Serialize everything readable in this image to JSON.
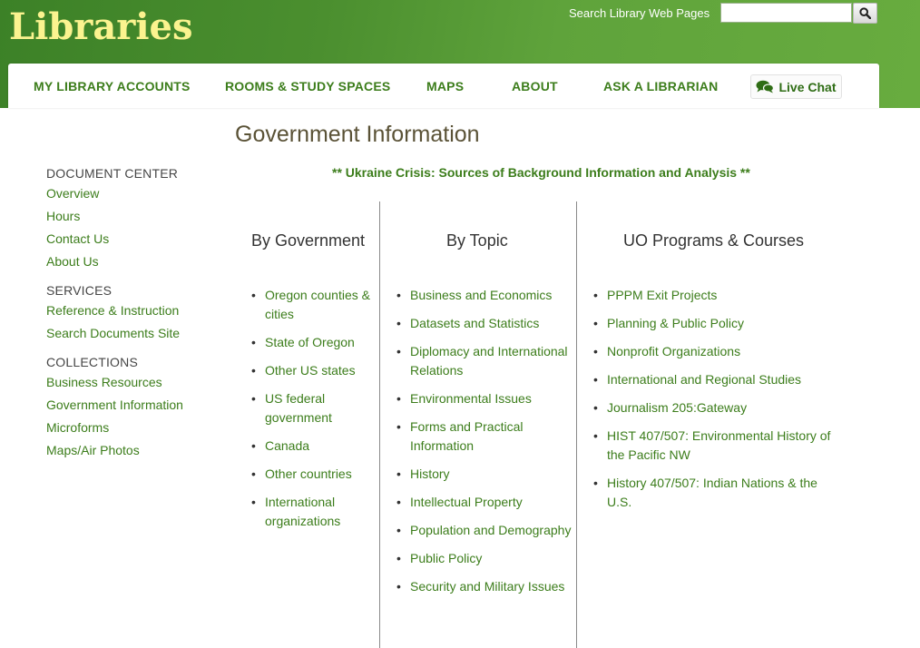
{
  "header": {
    "logo": "Libraries",
    "search_label": "Search Library Web Pages",
    "search_value": "",
    "search_icon": "magnifier-icon"
  },
  "nav": {
    "items": [
      "MY LIBRARY ACCOUNTS",
      "ROOMS & STUDY SPACES",
      "MAPS",
      "ABOUT",
      "ASK A LIBRARIAN"
    ],
    "live_chat": "Live Chat",
    "live_chat_icon": "chat-bubbles-icon"
  },
  "page": {
    "title": "Government Information",
    "announcement": "** Ukraine Crisis: Sources of Background Information and Analysis **"
  },
  "sidebar": {
    "sections": [
      {
        "heading": "DOCUMENT CENTER",
        "links": [
          "Overview",
          "Hours",
          "Contact Us",
          "About Us"
        ]
      },
      {
        "heading": "SERVICES",
        "links": [
          "Reference & Instruction",
          "Search Documents Site"
        ]
      },
      {
        "heading": "COLLECTIONS",
        "links": [
          "Business Resources",
          "Government Information",
          "Microforms",
          "Maps/Air Photos"
        ]
      }
    ]
  },
  "columns": [
    {
      "heading": "By Government",
      "items": [
        "Oregon counties & cities",
        "State of Oregon",
        "Other US states",
        "US federal government",
        "Canada",
        "Other countries",
        "International organizations"
      ]
    },
    {
      "heading": "By Topic",
      "items": [
        "Business and Economics",
        "Datasets and Statistics",
        "Diplomacy and International Relations",
        "Environmental Issues",
        "Forms and Practical Information",
        "History",
        "Intellectual Property",
        "Population and Demography",
        "Public Policy",
        "Security and Military Issues"
      ]
    },
    {
      "heading": "UO Programs & Courses",
      "items": [
        "PPPM Exit Projects",
        "Planning & Public Policy",
        "Nonprofit Organizations",
        "International and Regional Studies",
        "Journalism 205:Gateway",
        "HIST 407/507: Environmental History of the Pacific NW",
        "History 407/507: Indian Nations & the U.S."
      ]
    }
  ],
  "colors": {
    "header_green": "#4b8f2f",
    "logo_yellow": "#fbf38f",
    "link_green": "#3c7d1b",
    "title_brown": "#5a5236"
  }
}
